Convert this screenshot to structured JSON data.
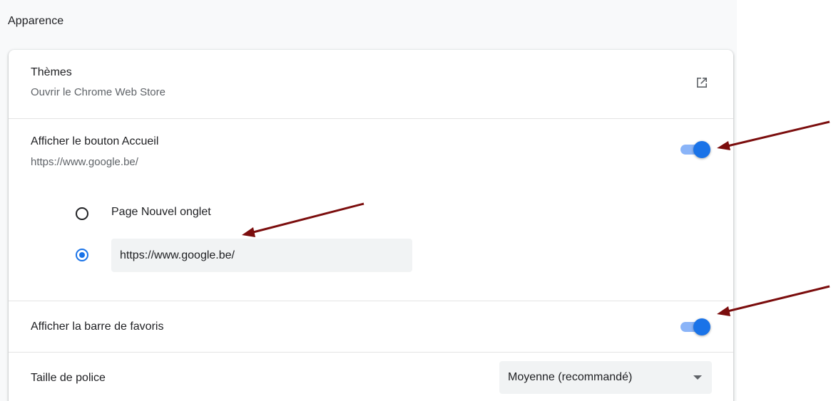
{
  "section": {
    "title": "Apparence"
  },
  "themes": {
    "label": "Thèmes",
    "sublabel": "Ouvrir le Chrome Web Store",
    "icon": "open-in-new-icon"
  },
  "home_button": {
    "label": "Afficher le bouton Accueil",
    "sublabel": "https://www.google.be/",
    "enabled": true,
    "options": [
      {
        "label": "Page Nouvel onglet",
        "selected": false
      },
      {
        "value": "https://www.google.be/",
        "selected": true
      }
    ]
  },
  "bookmarks_bar": {
    "label": "Afficher la barre de favoris",
    "enabled": true
  },
  "font_size": {
    "label": "Taille de police",
    "selected": "Moyenne (recommandé)"
  },
  "colors": {
    "accent": "#1a73e8",
    "toggle_track": "#8ab4f8",
    "annotation_arrow": "#7b0d0d"
  }
}
